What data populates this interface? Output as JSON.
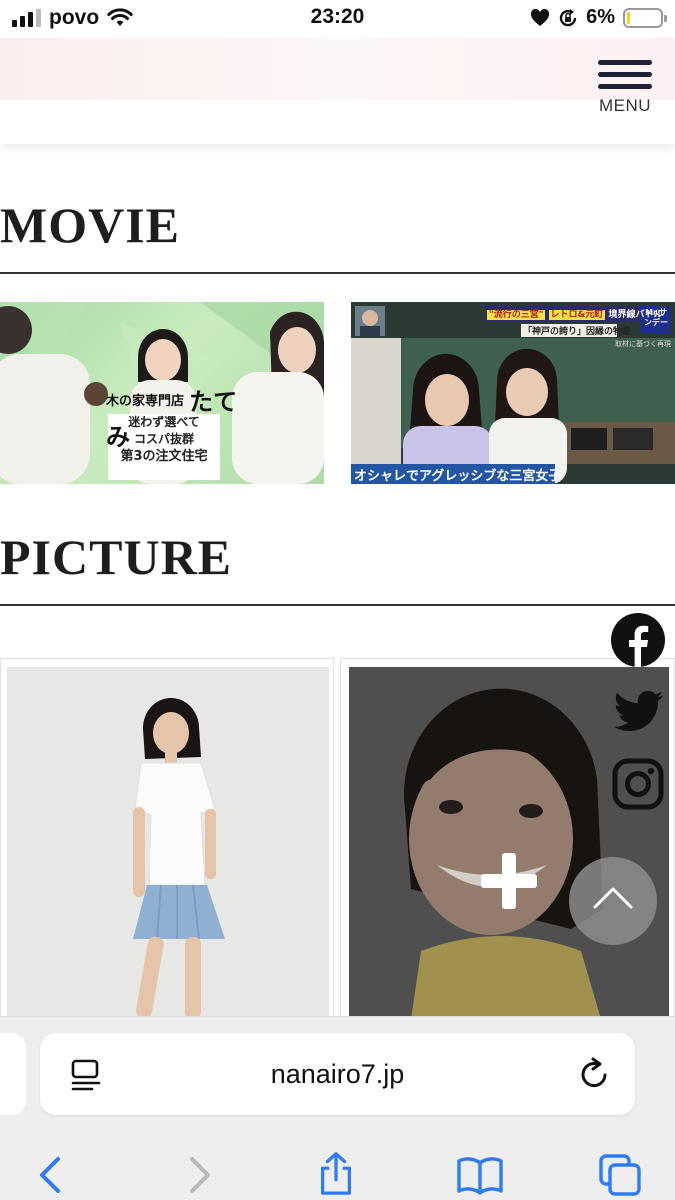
{
  "status_bar": {
    "carrier": "povo",
    "time": "23:20",
    "battery_percent": "6%",
    "battery_level": 0.06,
    "icons": [
      "signal-icon",
      "wifi-icon",
      "heart-icon",
      "rotation-lock-icon",
      "battery-icon"
    ]
  },
  "header": {
    "menu_label": "MENU",
    "band_color": "#fcf0f0",
    "menu_bar_color": "#1e2035"
  },
  "movie": {
    "title": "MOVIE",
    "videos": [
      {
        "brand": "木の家専門店",
        "brand_big": "たてみ",
        "caption_lines": [
          "迷わず選べて",
          "コスパ抜群",
          "第3の注文住宅"
        ]
      },
      {
        "top_tags": [
          "\"流行の三宮\"",
          "レトロ&元町",
          "境界線バトル"
        ],
        "channel": "Mr.サンデー",
        "story": "「神戸の誇り」因縁の物語",
        "source_note": "取材に基づく再現",
        "subtitle": "オシャレでアグレッシブな三宮女子"
      }
    ]
  },
  "picture": {
    "title": "PICTURE",
    "photos": [
      {
        "alt": "full-body portrait"
      },
      {
        "alt": "close-up smiling portrait"
      }
    ]
  },
  "floating": {
    "social_icons": [
      "facebook-icon",
      "twitter-icon",
      "instagram-icon"
    ],
    "scroll_top_icon": "chevron-up-icon",
    "expand_icon": "plus-icon"
  },
  "browser": {
    "url": "nanairo7.jp",
    "accent_color": "#2f7bf5",
    "toolbar": [
      "back-icon",
      "forward-icon",
      "share-icon",
      "bookmarks-icon",
      "tabs-icon"
    ]
  }
}
